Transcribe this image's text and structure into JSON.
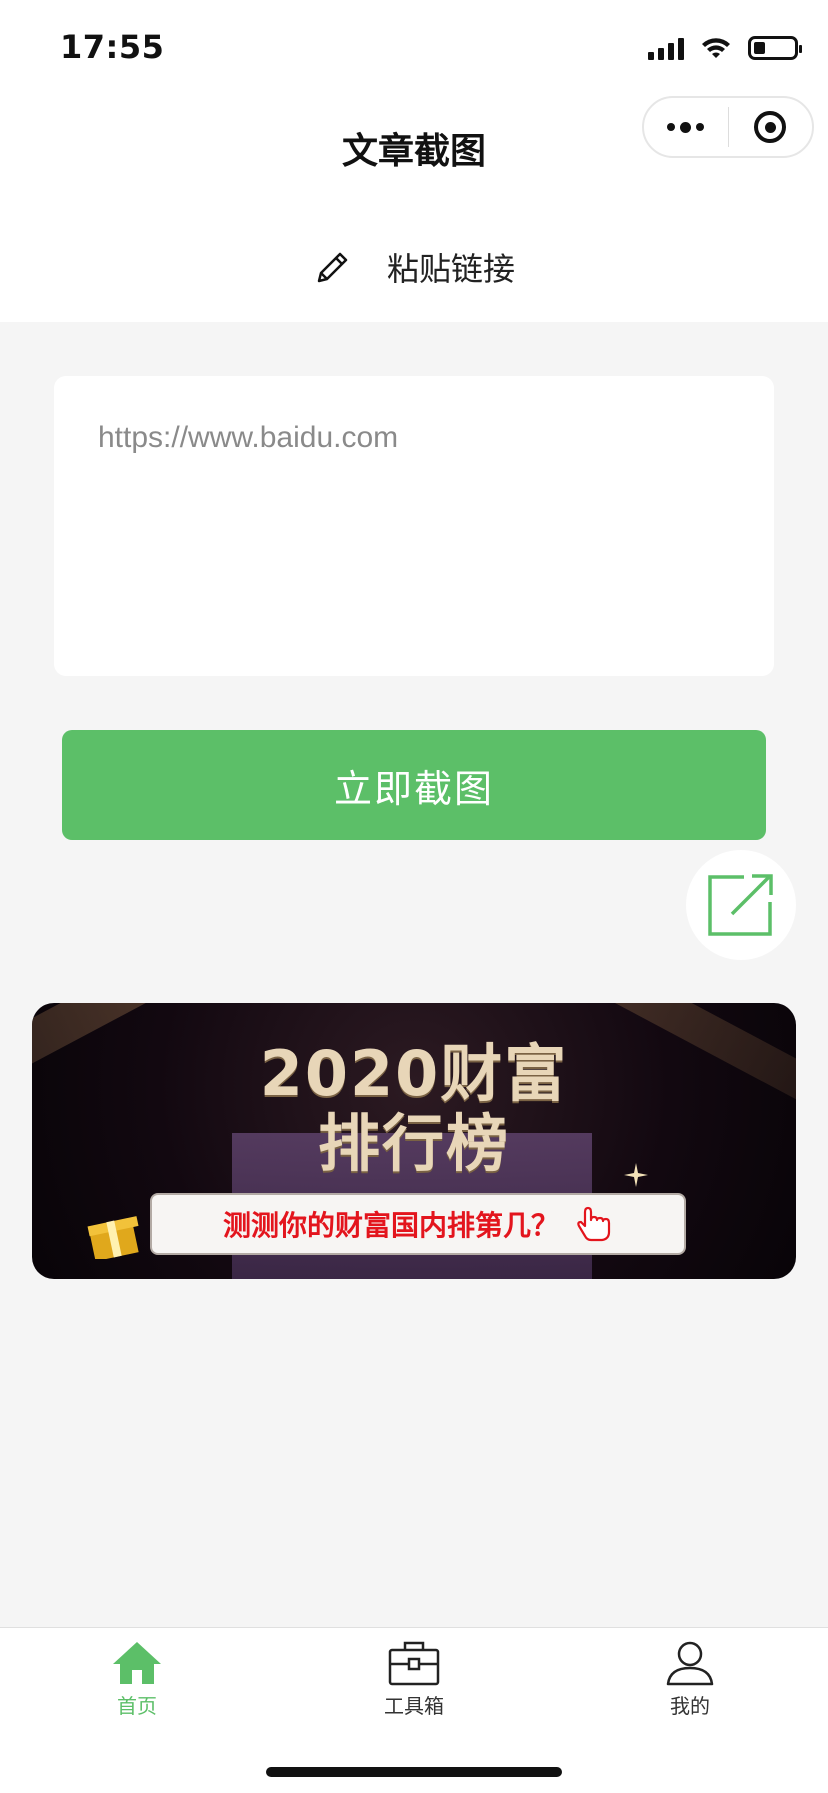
{
  "status_bar": {
    "time": "17:55",
    "battery_level": 0.3
  },
  "nav": {
    "title": "文章截图",
    "menu_icon": "more-dots-icon",
    "close_icon": "target-icon"
  },
  "paste": {
    "icon": "pencil-icon",
    "label": "粘贴链接"
  },
  "url_input": {
    "placeholder": "https://www.baidu.com",
    "value": ""
  },
  "capture_button": {
    "label": "立即截图"
  },
  "share_button": {
    "icon": "share-external-icon"
  },
  "banner": {
    "title_line1": "2020财富",
    "title_line2": "排行榜",
    "subtitle": "测测你的财富国内排第几？"
  },
  "tab_bar": {
    "items": [
      {
        "label": "首页",
        "icon": "home-icon",
        "active": true
      },
      {
        "label": "工具箱",
        "icon": "toolbox-icon",
        "active": false
      },
      {
        "label": "我的",
        "icon": "user-icon",
        "active": false
      }
    ]
  },
  "colors": {
    "accent": "#5cbf68",
    "background": "#f5f5f5",
    "banner_text": "#e8d6b8",
    "banner_highlight": "#e3151d"
  }
}
